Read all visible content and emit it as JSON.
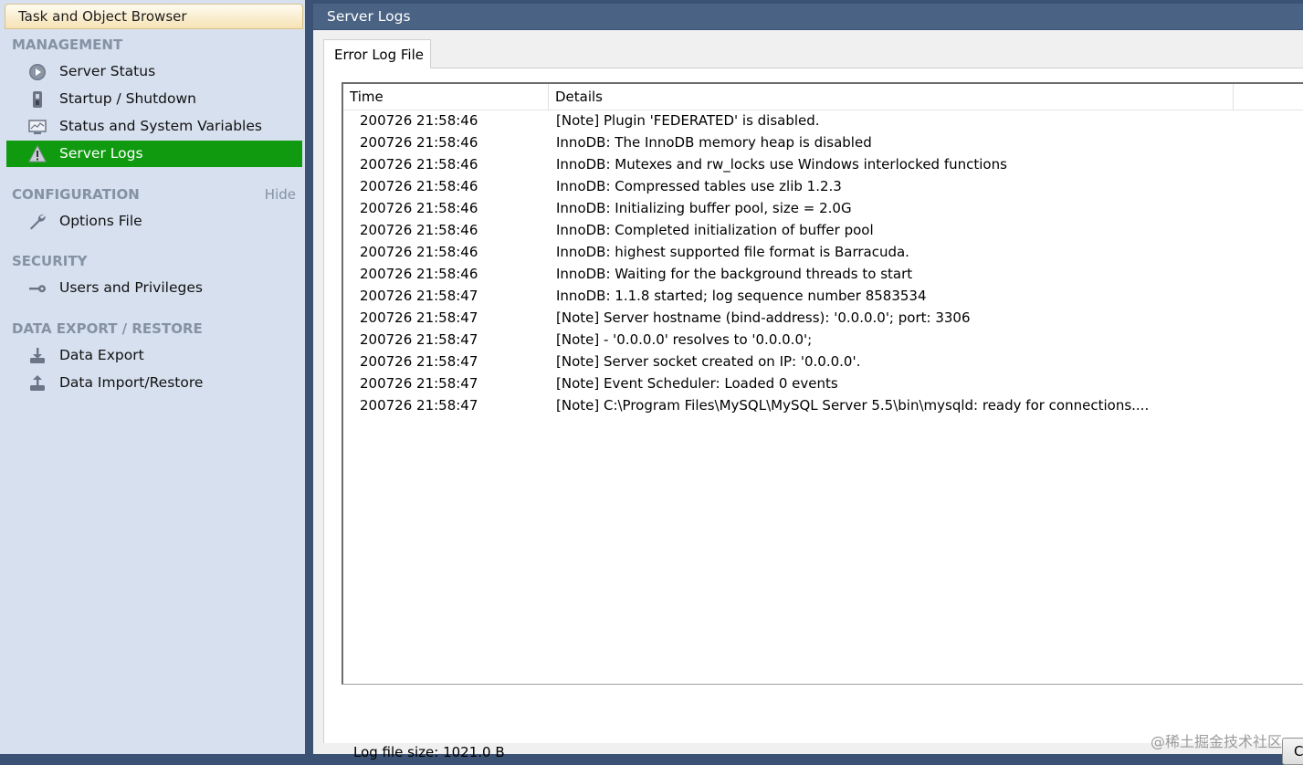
{
  "sidebar": {
    "header": "Task and Object Browser",
    "sections": {
      "management": {
        "title": "MANAGEMENT",
        "items": [
          {
            "label": "Server Status",
            "icon": "play-circle-icon"
          },
          {
            "label": "Startup / Shutdown",
            "icon": "power-switch-icon"
          },
          {
            "label": "Status and System Variables",
            "icon": "monitor-icon"
          },
          {
            "label": "Server Logs",
            "icon": "warning-icon",
            "active": true
          }
        ]
      },
      "configuration": {
        "title": "CONFIGURATION",
        "hide_label": "Hide",
        "items": [
          {
            "label": "Options File",
            "icon": "wrench-icon"
          }
        ]
      },
      "security": {
        "title": "SECURITY",
        "items": [
          {
            "label": "Users and Privileges",
            "icon": "key-icon"
          }
        ]
      },
      "data_export": {
        "title": "DATA EXPORT / RESTORE",
        "items": [
          {
            "label": "Data Export",
            "icon": "export-icon"
          },
          {
            "label": "Data Import/Restore",
            "icon": "import-icon"
          }
        ]
      }
    }
  },
  "main": {
    "title": "Server Logs",
    "tab_label": "Error Log File",
    "columns": {
      "time": "Time",
      "details": "Details"
    },
    "rows": [
      {
        "time": "200726 21:58:46",
        "details": "[Note] Plugin 'FEDERATED' is disabled."
      },
      {
        "time": "200726 21:58:46",
        "details": "InnoDB: The InnoDB memory heap is disabled"
      },
      {
        "time": "200726 21:58:46",
        "details": "InnoDB: Mutexes and rw_locks use Windows interlocked functions"
      },
      {
        "time": "200726 21:58:46",
        "details": "InnoDB: Compressed tables use zlib 1.2.3"
      },
      {
        "time": "200726 21:58:46",
        "details": "InnoDB: Initializing buffer pool, size = 2.0G"
      },
      {
        "time": "200726 21:58:46",
        "details": "InnoDB: Completed initialization of buffer pool"
      },
      {
        "time": "200726 21:58:46",
        "details": "InnoDB: highest supported file format is Barracuda."
      },
      {
        "time": "200726 21:58:46",
        "details": "InnoDB: Waiting for the background threads to start"
      },
      {
        "time": "200726 21:58:47",
        "details": "InnoDB: 1.1.8 started; log sequence number 8583534"
      },
      {
        "time": "200726 21:58:47",
        "details": "[Note] Server hostname (bind-address): '0.0.0.0'; port: 3306"
      },
      {
        "time": "200726 21:58:47",
        "details": "[Note]   - '0.0.0.0' resolves to '0.0.0.0';"
      },
      {
        "time": "200726 21:58:47",
        "details": "[Note] Server socket created on IP: '0.0.0.0'."
      },
      {
        "time": "200726 21:58:47",
        "details": "[Note] Event Scheduler: Loaded 0 events"
      },
      {
        "time": "200726 21:58:47",
        "details": "[Note] C:\\Program Files\\MySQL\\MySQL Server 5.5\\bin\\mysqld: ready for connections...."
      }
    ],
    "log_size_label": "Log file size: 1021.0 B",
    "copy_button_label": "Copy"
  },
  "watermark": "@稀土掘金技术社区",
  "colors": {
    "active_item": "#109a10",
    "sidebar_bg": "#d6e0ee",
    "title_bar": "#4a6283"
  }
}
